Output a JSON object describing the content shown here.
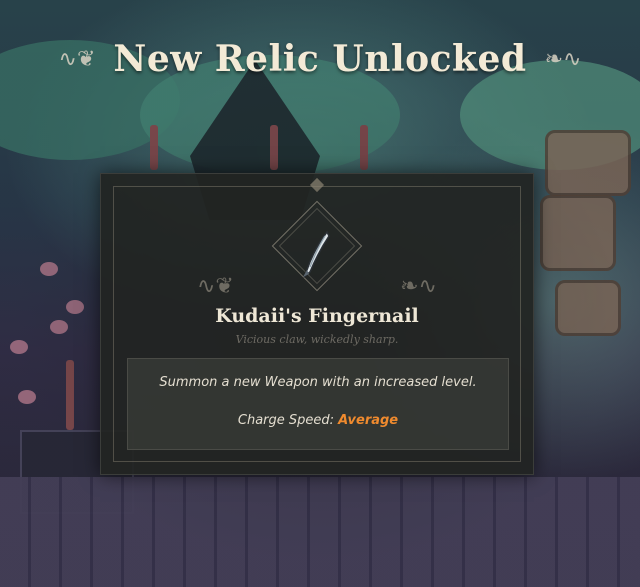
{
  "header": {
    "title": "New Relic Unlocked",
    "flourish_left": "∿❦",
    "flourish_right": "❧∿"
  },
  "relic": {
    "icon": "claw-fingernail-icon",
    "name": "Kudaii's Fingernail",
    "flavor": "Vicious claw, wickedly sharp.",
    "description": "Summon a new Weapon with an increased level.",
    "charge_label": "Charge Speed:",
    "charge_value": "Average"
  },
  "colors": {
    "title": "#f3ead6",
    "card_bg": "#222422",
    "charge_value": "#ef8a2e"
  }
}
